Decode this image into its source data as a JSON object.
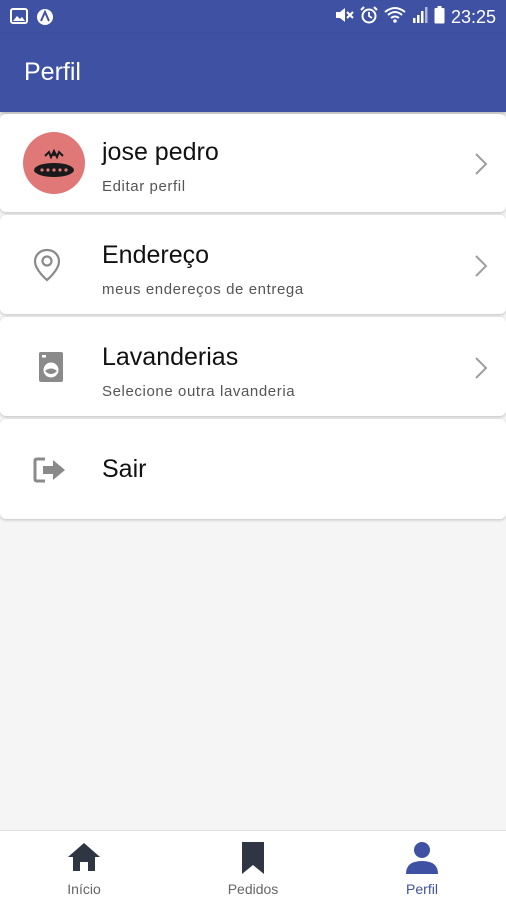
{
  "status_bar": {
    "time": "23:25",
    "left_icons": [
      "image-icon",
      "app-a-icon"
    ],
    "right_icons": [
      "mute-icon",
      "alarm-icon",
      "wifi-icon",
      "signal-icon",
      "battery-icon"
    ]
  },
  "app_bar": {
    "title": "Perfil",
    "color": "#3f51a3"
  },
  "profile": {
    "name": "jose pedro",
    "subtitle": "Editar perfil"
  },
  "menu": [
    {
      "title": "Endereço",
      "subtitle": "meus endereços de entrega",
      "icon": "location-pin-icon"
    },
    {
      "title": "Lavanderias",
      "subtitle": "Selecione outra lavanderia",
      "icon": "washing-machine-icon"
    },
    {
      "title": "Sair",
      "icon": "logout-icon"
    }
  ],
  "bottom_nav": {
    "items": [
      {
        "label": "Início",
        "icon": "home-icon"
      },
      {
        "label": "Pedidos",
        "icon": "bookmark-icon"
      },
      {
        "label": "Perfil",
        "icon": "person-icon"
      }
    ],
    "active": "Perfil",
    "active_color": "#3f51a3",
    "inactive_color": "#2f3542"
  }
}
